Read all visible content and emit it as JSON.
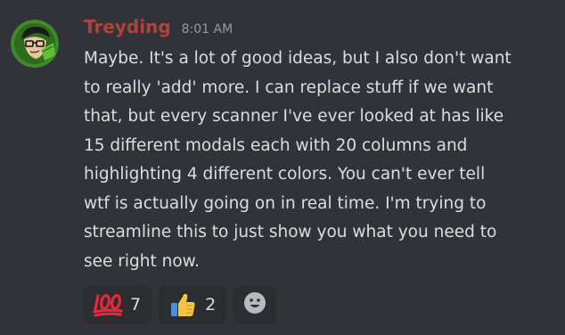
{
  "message": {
    "username": "Treyding",
    "timestamp": "8:01 AM",
    "lines": [
      "Maybe. It's a lot of good ideas, but I also don't want",
      "to really 'add' more. I can replace stuff if we want",
      "that, but every scanner I've ever looked at has like",
      "15 different modals each with 20 columns and",
      "highlighting 4 different colors. You can't ever tell",
      "wtf is actually going on in real time. I'm trying to",
      "streamline this to just show you what you need to",
      "see right now."
    ]
  },
  "reactions": [
    {
      "emoji": "hundred-points-icon",
      "count": "7"
    },
    {
      "emoji": "thumbs-up-icon",
      "count": "2"
    }
  ],
  "add_reaction_icon": "smiley-face-icon",
  "colors": {
    "background": "#313338",
    "username": "#ae433d",
    "text": "#dbdee1",
    "timestamp": "#949ba4",
    "reaction_bg": "#2b2d31"
  }
}
